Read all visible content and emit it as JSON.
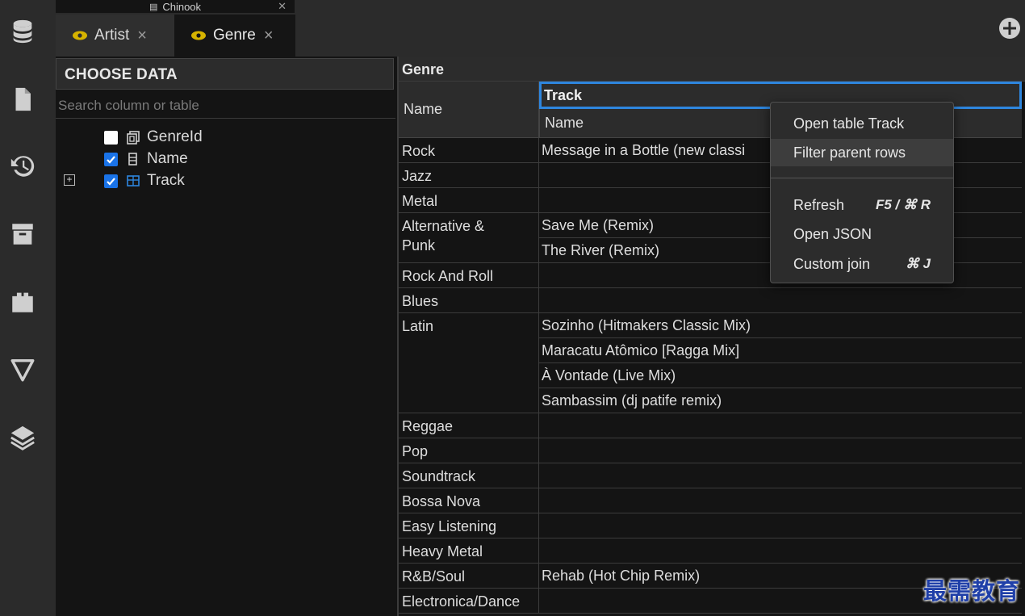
{
  "connection": {
    "name": "Chinook"
  },
  "tabs": [
    {
      "label": "Artist"
    },
    {
      "label": "Genre"
    }
  ],
  "choose_data": {
    "header": "CHOOSE DATA",
    "search_placeholder": "Search column or table",
    "items": [
      {
        "label": "GenreId",
        "checked": false,
        "icon": "key-column-icon"
      },
      {
        "label": "Name",
        "checked": true,
        "icon": "column-icon"
      },
      {
        "label": "Track",
        "checked": true,
        "icon": "table-icon"
      }
    ]
  },
  "grid": {
    "table_title": "Genre",
    "column_name": "Name",
    "nested_table": "Track",
    "nested_column": "Name",
    "rows": [
      {
        "genre": "Rock",
        "tracks": [
          "Message in a Bottle (new classi"
        ]
      },
      {
        "genre": "Jazz",
        "tracks": [
          ""
        ]
      },
      {
        "genre": "Metal",
        "tracks": [
          ""
        ]
      },
      {
        "genre": "Alternative & Punk",
        "tracks": [
          "Save Me (Remix)",
          "The River (Remix)"
        ]
      },
      {
        "genre": "Rock And Roll",
        "tracks": [
          ""
        ]
      },
      {
        "genre": "Blues",
        "tracks": [
          ""
        ]
      },
      {
        "genre": "Latin",
        "tracks": [
          "Sozinho (Hitmakers Classic Mix)",
          "Maracatu Atômico [Ragga Mix]",
          "À Vontade (Live Mix)",
          "Sambassim (dj patife remix)"
        ]
      },
      {
        "genre": "Reggae",
        "tracks": [
          ""
        ]
      },
      {
        "genre": "Pop",
        "tracks": [
          ""
        ]
      },
      {
        "genre": "Soundtrack",
        "tracks": [
          ""
        ]
      },
      {
        "genre": "Bossa Nova",
        "tracks": [
          ""
        ]
      },
      {
        "genre": "Easy Listening",
        "tracks": [
          ""
        ]
      },
      {
        "genre": "Heavy Metal",
        "tracks": [
          ""
        ]
      },
      {
        "genre": "R&B/Soul",
        "tracks": [
          "Rehab (Hot Chip Remix)"
        ]
      },
      {
        "genre": "Electronica/Dance",
        "tracks": [
          ""
        ]
      }
    ]
  },
  "context_menu": {
    "open_table": "Open table Track",
    "filter_parent": "Filter parent rows",
    "refresh": "Refresh",
    "refresh_shortcut": "F5 / ⌘ R",
    "open_json": "Open JSON",
    "custom_join": "Custom join",
    "custom_join_shortcut": "⌘ J"
  },
  "colors": {
    "accent": "#2e86de",
    "checkbox_on": "#1a73e8",
    "eye_icon": "#d6b300",
    "panel_bg": "#141414",
    "chrome_bg": "#2b2b2b"
  },
  "watermark": "最需教育"
}
